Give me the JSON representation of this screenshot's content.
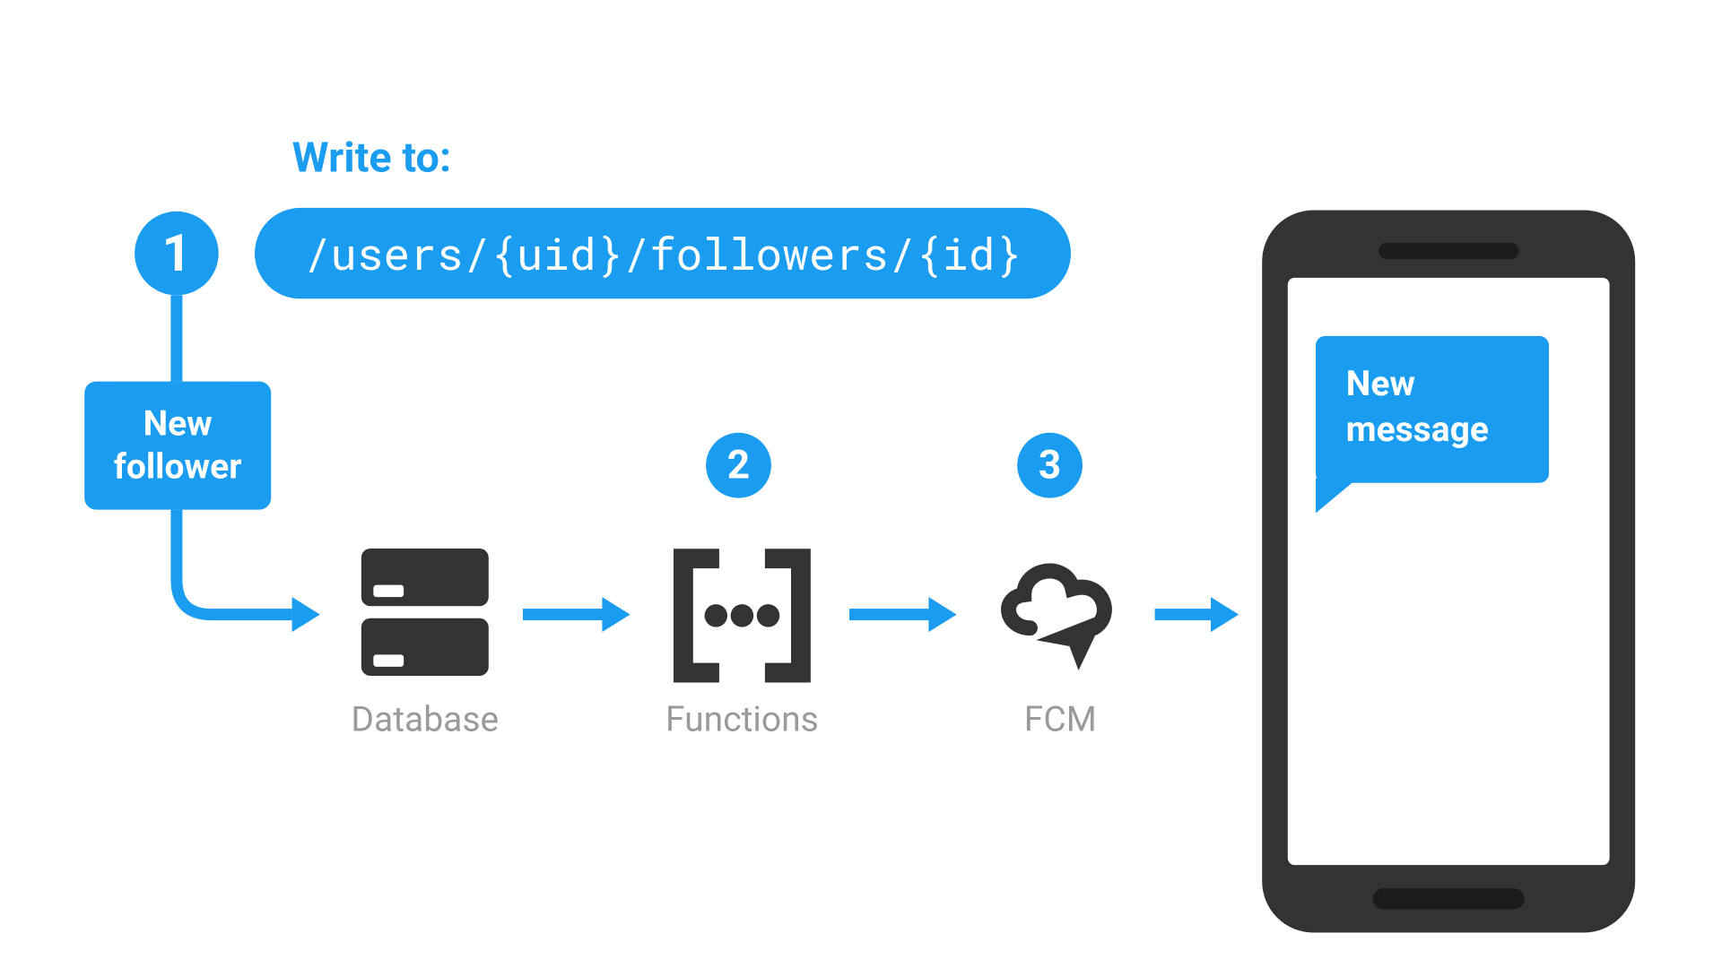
{
  "header": {
    "write_label": "Write to:",
    "path": "/users/{uid}/followers/{id}"
  },
  "steps": {
    "one": "1",
    "two": "2",
    "three": "3"
  },
  "trigger_box": {
    "line1": "New",
    "line2": "follower"
  },
  "nodes": {
    "database": "Database",
    "functions": "Functions",
    "fcm": "FCM"
  },
  "phone": {
    "bubble_line1": "New",
    "bubble_line2": "message"
  },
  "colors": {
    "accent": "#1a9cf0",
    "icon": "#333333",
    "label": "#9a9a9a"
  }
}
